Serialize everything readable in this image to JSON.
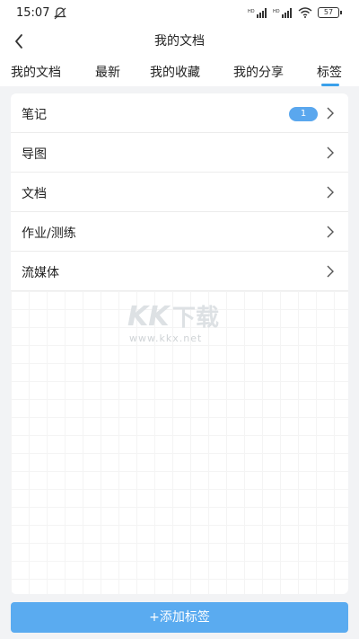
{
  "status": {
    "time": "15:07",
    "battery": "57",
    "network": "HD"
  },
  "header": {
    "title": "我的文档"
  },
  "tabs": [
    {
      "label": "我的文档"
    },
    {
      "label": "最新"
    },
    {
      "label": "我的收藏"
    },
    {
      "label": "我的分享"
    },
    {
      "label": "标签"
    }
  ],
  "list": [
    {
      "label": "笔记",
      "badge": "1"
    },
    {
      "label": "导图"
    },
    {
      "label": "文档"
    },
    {
      "label": "作业/测练"
    },
    {
      "label": "流媒体"
    }
  ],
  "watermark": {
    "logo": "KK下载",
    "url": "www.kkx.net"
  },
  "footer": {
    "add_label": "+添加标签"
  },
  "colors": {
    "accent": "#5aabf0",
    "badge": "#5aa7ee",
    "underline": "#3aa0ea"
  }
}
